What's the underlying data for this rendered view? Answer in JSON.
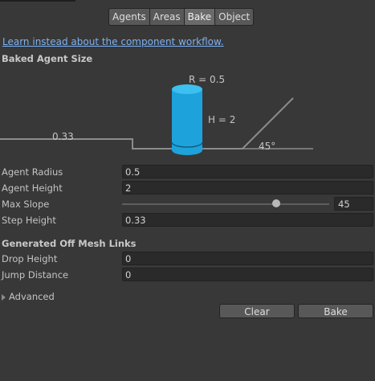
{
  "tabs": [
    "Agents",
    "Areas",
    "Bake",
    "Object"
  ],
  "active_tab": "Bake",
  "link_text": "Learn instead about the component workflow.",
  "section_agent_size": "Baked Agent Size",
  "diagram": {
    "radius_label": "R = 0.5",
    "height_label": "H = 2",
    "step_label": "0.33",
    "slope_label": "45°"
  },
  "fields": {
    "agent_radius": {
      "label": "Agent Radius",
      "value": "0.5"
    },
    "agent_height": {
      "label": "Agent Height",
      "value": "2"
    },
    "max_slope": {
      "label": "Max Slope",
      "value": "45",
      "fraction": 0.75
    },
    "step_height": {
      "label": "Step Height",
      "value": "0.33"
    }
  },
  "section_offmesh": "Generated Off Mesh Links",
  "offmesh": {
    "drop_height": {
      "label": "Drop Height",
      "value": "0"
    },
    "jump_distance": {
      "label": "Jump Distance",
      "value": "0"
    }
  },
  "advanced_label": "Advanced",
  "buttons": {
    "clear": "Clear",
    "bake": "Bake"
  },
  "colors": {
    "background": "#383838",
    "cylinder": "#1ea2dc",
    "link": "#7bb1f2",
    "diagram_line": "#8c8c8c"
  }
}
